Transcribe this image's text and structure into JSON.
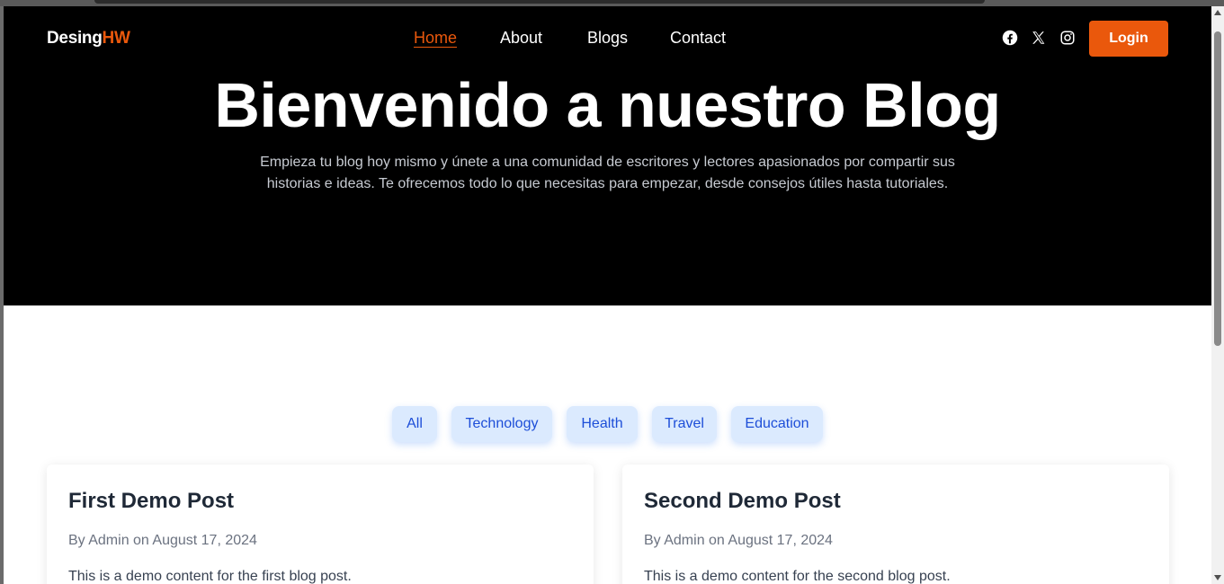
{
  "brand": {
    "name": "Desing",
    "accent": "HW",
    "accent_color": "#ea580c"
  },
  "nav": {
    "items": [
      {
        "label": "Home",
        "active": true
      },
      {
        "label": "About",
        "active": false
      },
      {
        "label": "Blogs",
        "active": false
      },
      {
        "label": "Contact",
        "active": false
      }
    ]
  },
  "social": {
    "icons": [
      "facebook-icon",
      "x-twitter-icon",
      "instagram-icon"
    ]
  },
  "login": {
    "label": "Login"
  },
  "hero": {
    "title": "Bienvenido a nuestro Blog",
    "subtitle": "Empieza tu blog hoy mismo y únete a una comunidad de escritores y lectores apasionados por compartir sus historias e ideas. Te ofrecemos todo lo que necesitas para empezar, desde consejos útiles hasta tutoriales."
  },
  "filters": [
    "All",
    "Technology",
    "Health",
    "Travel",
    "Education"
  ],
  "posts": [
    {
      "title": "First Demo Post",
      "meta": "By Admin on August 17, 2024",
      "excerpt": "This is a demo content for the first blog post."
    },
    {
      "title": "Second Demo Post",
      "meta": "By Admin on August 17, 2024",
      "excerpt": "This is a demo content for the second blog post."
    }
  ],
  "colors": {
    "hero_bg": "#000000",
    "chip_bg": "#dbeafe",
    "chip_text": "#1d4ed8"
  }
}
